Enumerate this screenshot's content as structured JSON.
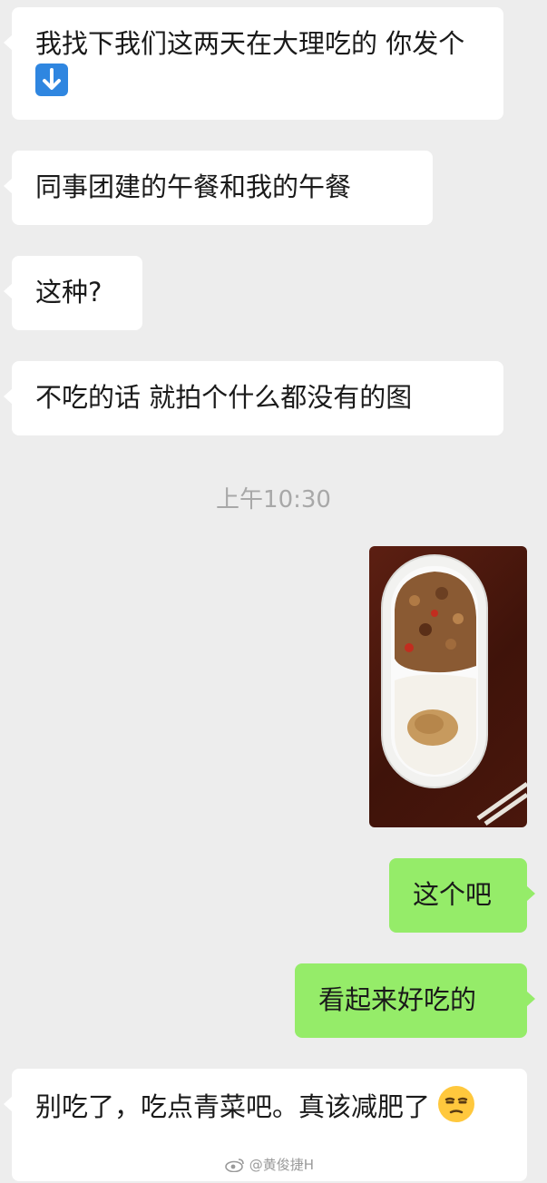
{
  "messages": [
    {
      "side": "left",
      "text": "我找下我们这两天在大理吃的 你发个",
      "emoji": "down-arrow-emoji"
    },
    {
      "side": "left",
      "text": "同事团建的午餐和我的午餐"
    },
    {
      "side": "left",
      "text": "这种?"
    },
    {
      "side": "left",
      "text": "不吃的话 就拍个什么都没有的图"
    },
    {
      "side": "right",
      "text": "这个吧"
    },
    {
      "side": "right",
      "text": "看起来好吃的"
    },
    {
      "side": "left",
      "text": "别吃了，吃点青菜吧。真该减肥了",
      "emoji": "unamused-face-emoji"
    }
  ],
  "timestamp": "上午10:30",
  "photo": {
    "description_icon": "lunch-box-photo"
  },
  "watermark": "@黄俊捷H",
  "colors": {
    "background": "#ededed",
    "left_bubble": "#ffffff",
    "right_bubble": "#95ec69",
    "timestamp": "#a8a8a8"
  }
}
